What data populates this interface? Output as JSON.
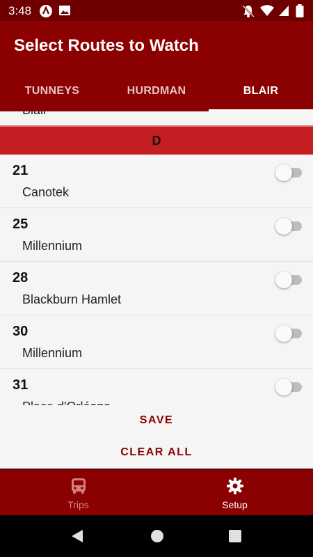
{
  "status_bar": {
    "time": "3:48"
  },
  "app_bar": {
    "title": "Select Routes to Watch"
  },
  "tabs": [
    {
      "label": "TUNNEYS"
    },
    {
      "label": "HURDMAN"
    },
    {
      "label": "BLAIR"
    }
  ],
  "list": {
    "clipped_previous": "Blair",
    "section_header": "D",
    "routes": [
      {
        "number": "21",
        "name": "Canotek",
        "enabled": false
      },
      {
        "number": "25",
        "name": "Millennium",
        "enabled": false
      },
      {
        "number": "28",
        "name": "Blackburn Hamlet",
        "enabled": false
      },
      {
        "number": "30",
        "name": "Millennium",
        "enabled": false
      },
      {
        "number": "31",
        "name": "Place d'Orléans",
        "enabled": false
      }
    ]
  },
  "actions": {
    "save_label": "SAVE",
    "clear_label": "CLEAR ALL"
  },
  "bottom_nav": {
    "trips_label": "Trips",
    "setup_label": "Setup"
  },
  "colors": {
    "primary": "#8b0000",
    "status_bar": "#6f0000",
    "section_header": "#c41e23"
  },
  "icons": [
    "notification-icon",
    "image-icon",
    "notifications-off-icon",
    "wifi-icon",
    "signal-icon",
    "battery-icon",
    "bus-icon",
    "gear-icon",
    "back-icon",
    "home-icon",
    "recents-icon"
  ]
}
